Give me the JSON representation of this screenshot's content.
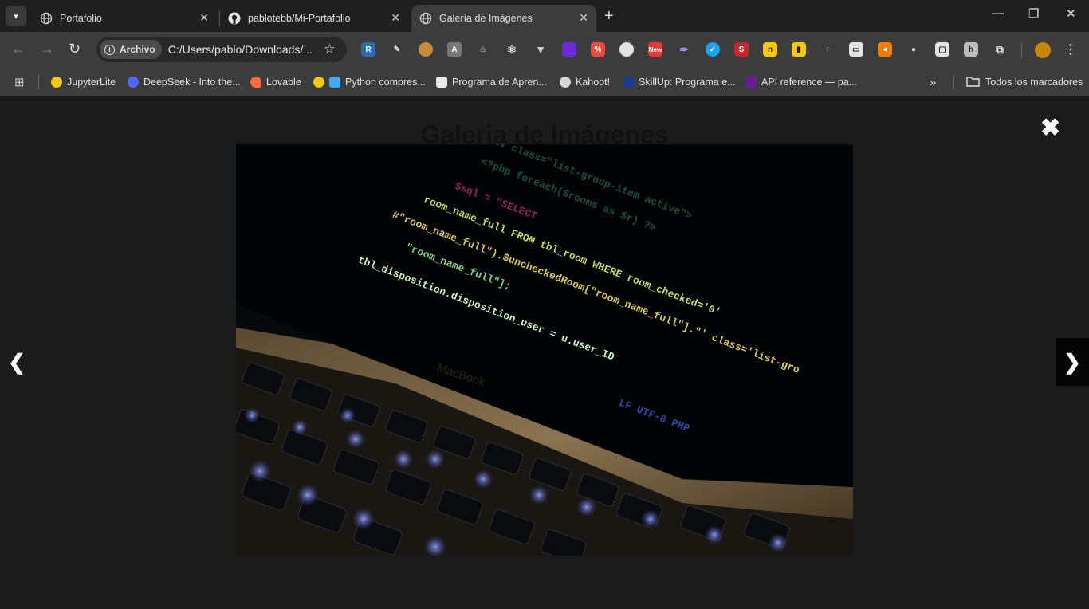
{
  "tabs": [
    {
      "title": "Portafolio",
      "icon": "globe-icon",
      "active": false
    },
    {
      "title": "pablotebb/Mi-Portafolio",
      "icon": "github-icon",
      "active": false
    },
    {
      "title": "Galería de Imágenes",
      "icon": "globe-icon",
      "active": true
    }
  ],
  "toolbar": {
    "chip_label": "Archivo",
    "url": "C:/Users/pablo/Downloads/..."
  },
  "bookmarks": [
    {
      "label": "JupyterLite",
      "color": "#f2c811"
    },
    {
      "label": "DeepSeek - Into the...",
      "color": "#4d6bfe"
    },
    {
      "label": "Lovable",
      "color": "#ff6b3d"
    },
    {
      "label": "Python compres...",
      "color": "#3fa9f5"
    },
    {
      "label": "Programa de Apren...",
      "color": "#e8e8e8"
    },
    {
      "label": "Kahoot!",
      "color": "#d9d9d9"
    },
    {
      "label": "SkillUp: Programa e...",
      "color": "#1b3a8a"
    },
    {
      "label": "API reference — pa...",
      "color": "#6a1b9a"
    }
  ],
  "all_bookmarks_label": "Todos los marcadores",
  "page": {
    "title": "Galeria de Imágenes",
    "close_glyph": "✖",
    "prev_glyph": "❮",
    "next_glyph": "❯"
  },
  "photo_text": {
    "brand": "MacBook",
    "code_lines": [
      "room_name_full FROM tbl_room WHERE room_checked='0'",
      "#\"room_name_full\").$uncheckedRoom[\"room_name_full\"].\"' class='list-gro",
      "tbl_disposition.disposition_user = u.user_ID",
      "\"room_name_full\"];"
    ]
  }
}
